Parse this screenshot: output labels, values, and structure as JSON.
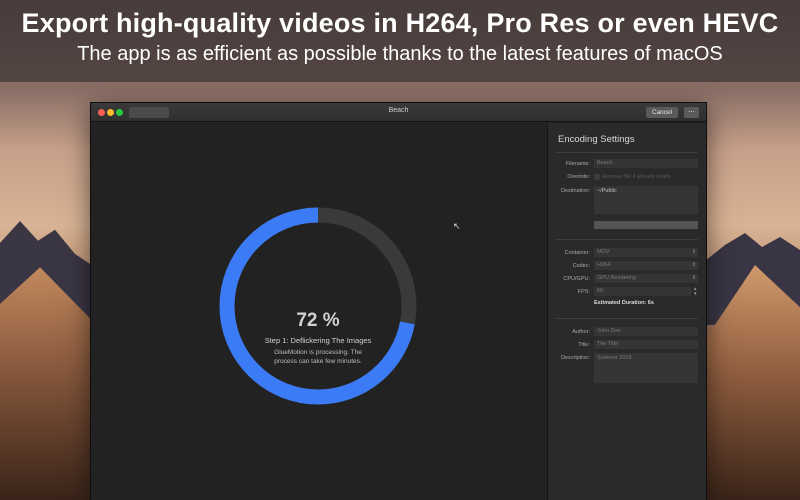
{
  "banner": {
    "headline": "Export high-quality videos in H264, Pro Res or even HEVC",
    "subline": "The app is as efficient as possible thanks to the latest features of macOS"
  },
  "window": {
    "title": "Beach",
    "cancel_label": "Cancel",
    "more_label": "⋯"
  },
  "progress": {
    "percent_text": "72 %",
    "value": 0.72,
    "step_label": "Step 1: Deflickering The Images",
    "description": "GlueMotion is processing. The process can take few minutes.",
    "ring_color": "#3b7cf6",
    "track_color": "#3a3a3a"
  },
  "settings": {
    "title": "Encoding Settings",
    "filename_label": "Filename:",
    "filename_value": "Beach",
    "override_label": "Override:",
    "override_text": "Remove file if already exists",
    "destination_label": "Destination:",
    "destination_value": "~/Public",
    "container_label": "Container:",
    "container_value": "MOV",
    "codec_label": "Codec:",
    "codec_value": "H264",
    "cpu_label": "CPU/GPU:",
    "cpu_value": "GPU Rendering",
    "fps_label": "FPS:",
    "fps_value": "60",
    "duration_text": "Estimated Duration: 6s",
    "author_label": "Author:",
    "author_placeholder": "John Doe",
    "title_label": "Title:",
    "title_placeholder": "The Title",
    "description_label": "Description:",
    "description_placeholder": "Summer 2018"
  }
}
